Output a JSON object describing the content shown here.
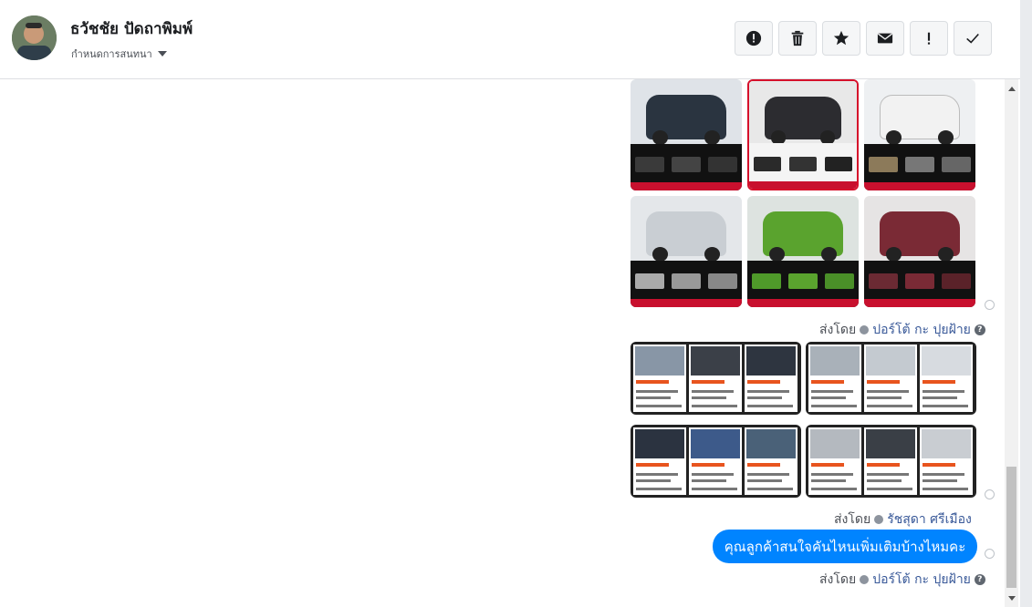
{
  "header": {
    "name": "ธวัชชัย ปัดถาพิมพ์",
    "subtitle": "กำหนดการสนทนา"
  },
  "toolbar": {
    "buttons": [
      {
        "icon": "alert-circle-icon",
        "label": "mark-spam"
      },
      {
        "icon": "trash-icon",
        "label": "delete"
      },
      {
        "icon": "star-icon",
        "label": "star"
      },
      {
        "icon": "envelope-icon",
        "label": "mark-unread"
      },
      {
        "icon": "exclamation-icon",
        "label": "flag"
      },
      {
        "icon": "check-icon",
        "label": "done"
      }
    ]
  },
  "messages": {
    "sent_by_1": {
      "prefix": "ส่งโดย",
      "who": "ปอร์โต้ กะ ปุยฝ้าย"
    },
    "sent_by_2": {
      "prefix": "ส่งโดย",
      "who": "รัชสุดา ศรีเมือง"
    },
    "sent_by_3": {
      "prefix": "ส่งโดย",
      "who": "ปอร์โต้ กะ ปุยฝ้าย"
    },
    "bubble_text": "คุณลูกค้าสนใจคันไหนเพิ่มเติมบ้างไหมคะ"
  },
  "colors": {
    "accent": "#0084ff",
    "link": "#385898"
  }
}
